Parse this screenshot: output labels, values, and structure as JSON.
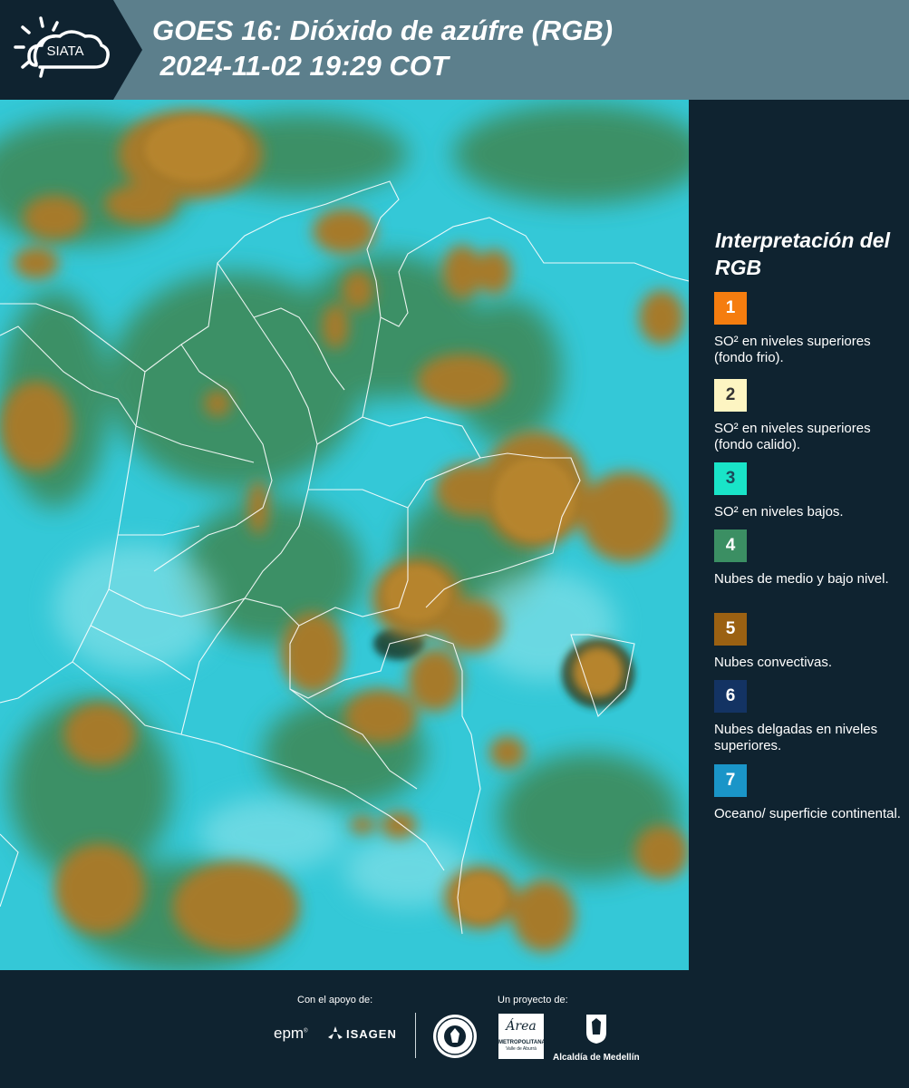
{
  "header": {
    "logo_text": "SIATA",
    "title_line1": "GOES 16: Dióxido de azúfre (RGB)",
    "title_line2": " 2024-11-02 19:29 COT"
  },
  "legend": {
    "title": "Interpretación del RGB",
    "items": [
      {
        "number": "1",
        "color": "#f57d0f",
        "number_color": "#ffffff",
        "text": "SO² en niveles superiores (fondo frio)."
      },
      {
        "number": "2",
        "color": "#fdf5c2",
        "number_color": "#333333",
        "text": "SO² en niveles superiores (fondo calido)."
      },
      {
        "number": "3",
        "color": "#19e4c8",
        "number_color": "#1b4a5a",
        "text": "SO² en niveles bajos."
      },
      {
        "number": "4",
        "color": "#3b8f63",
        "number_color": "#ffffff",
        "text": "Nubes de medio y bajo nivel."
      },
      {
        "number": "5",
        "color": "#9b6112",
        "number_color": "#ffffff",
        "text": "Nubes convectivas."
      },
      {
        "number": "6",
        "color": "#133363",
        "number_color": "#ffffff",
        "text": "Nubes delgadas en niveles superiores."
      },
      {
        "number": "7",
        "color": "#1a95c8",
        "number_color": "#ffffff",
        "text": "Oceano/ superficie continental."
      }
    ]
  },
  "footer": {
    "support_label": "Con el apoyo de:",
    "project_label": "Un proyecto de:",
    "sponsor1": "epm",
    "sponsor2": "ISAGEN",
    "partner_metro_line1": "METROPOLITANA",
    "partner_metro_line2": "Valle de Aburrá",
    "partner_metro_script": "Área",
    "partner_alcaldia": "Alcaldía de Medellín"
  },
  "colors": {
    "header_bg": "#5c7f8c",
    "panel_bg": "#0f2330",
    "sea_cyan": "#2fc7d6",
    "cloud_brown": "#a67a2c",
    "cloud_green": "#3d8a5a"
  },
  "icons": [
    "sun-cloud-logo-icon",
    "epm-logo",
    "isagen-logo",
    "seal-logo",
    "metropolitana-logo",
    "alcaldia-logo"
  ]
}
